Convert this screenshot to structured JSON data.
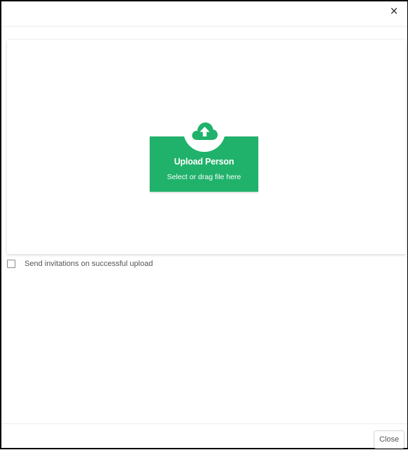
{
  "dialog": {
    "close_glyph": "×"
  },
  "upload": {
    "title": "Upload Person",
    "subtitle": "Select or drag file here",
    "icon": "cloud-upload-icon"
  },
  "options": {
    "send_invitations_label": "Send invitations on successful upload",
    "send_invitations_checked": false
  },
  "footer": {
    "close_label": "Close"
  },
  "colors": {
    "accent": "#20b26b"
  }
}
